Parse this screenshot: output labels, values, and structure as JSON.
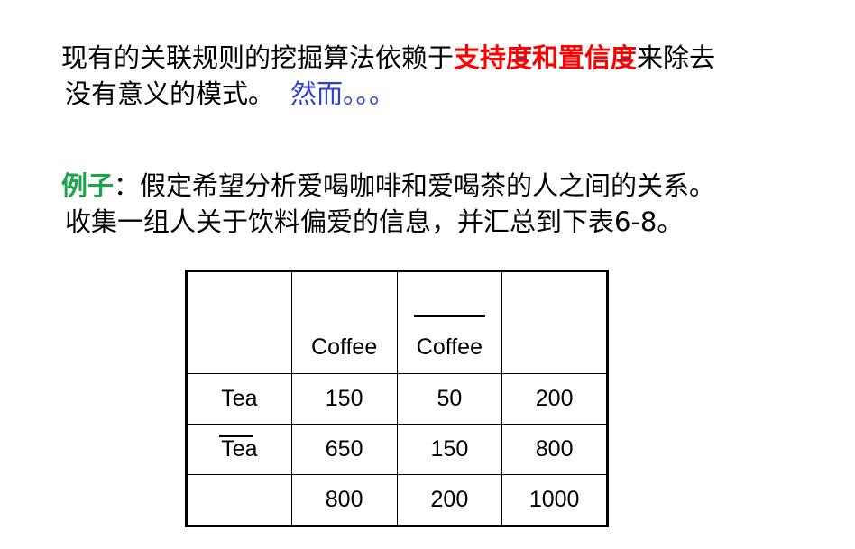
{
  "intro": {
    "line1_before": "现有的关联规则的挖掘算法依赖于",
    "line1_emphasis": "支持度和置信度",
    "line1_after": "来除去",
    "line2_text": "没有意义的模式。",
    "line2_emphasis": "然而。。。"
  },
  "example": {
    "label": "例子",
    "colon": "：",
    "line1_text": "假定希望分析爱喝咖啡和爱喝茶的人之间的关系。",
    "line2_text": "收集一组人关于饮料偏爱的信息，并汇总到下表6-8。"
  },
  "table": {
    "headers": [
      "",
      "Coffee",
      "Coffee",
      ""
    ],
    "negated_header_index": 2,
    "rows": [
      {
        "label": "Tea",
        "negated": false,
        "values": [
          "150",
          "50",
          "200"
        ]
      },
      {
        "label": "Tea",
        "negated": true,
        "values": [
          "650",
          "150",
          "800"
        ]
      },
      {
        "label": "",
        "negated": false,
        "values": [
          "800",
          "200",
          "1000"
        ]
      }
    ]
  },
  "colors": {
    "emphasis_red": "#ff0000",
    "emphasis_blue": "#2e3fd6",
    "label_green": "#1aa54a"
  }
}
